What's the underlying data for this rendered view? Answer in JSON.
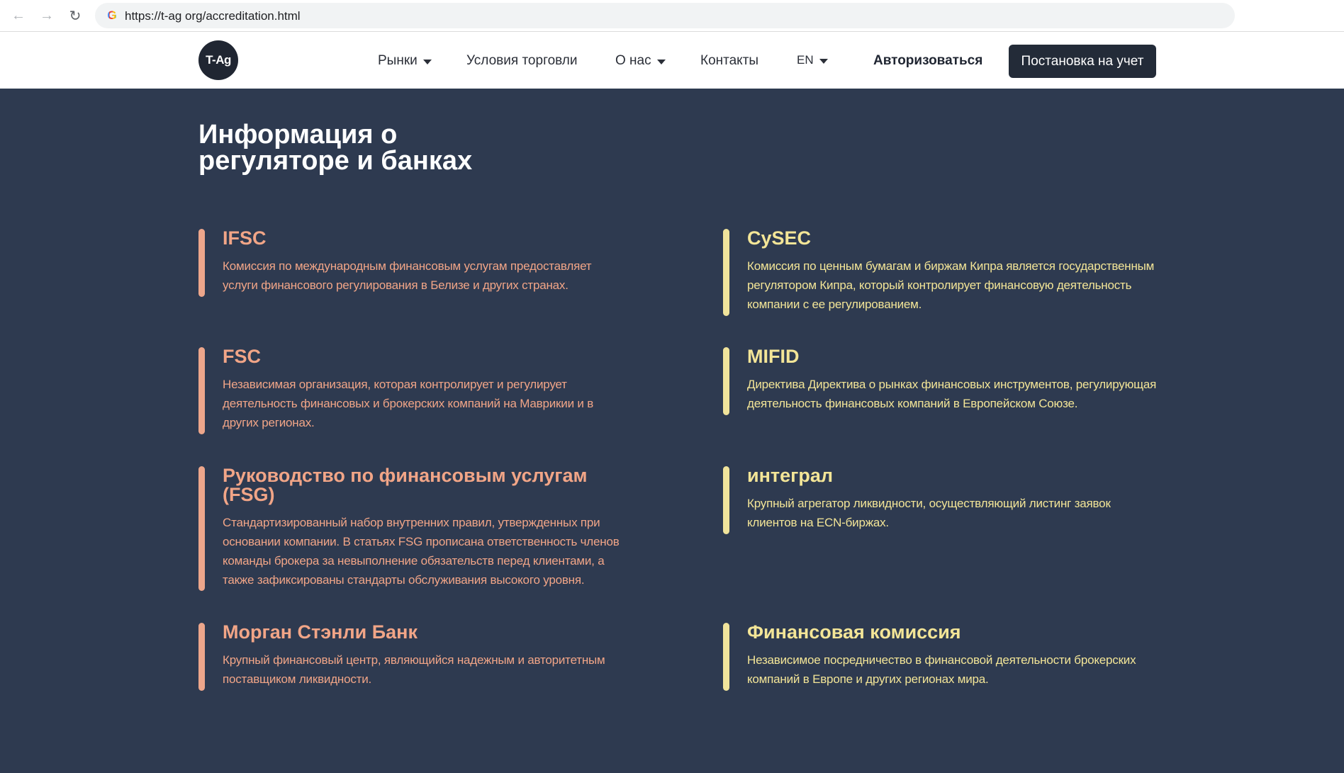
{
  "browser": {
    "url": "https://t-ag org/accreditation.html"
  },
  "header": {
    "logo_text": "T-Ag",
    "menu": [
      {
        "label": "Рынки",
        "dropdown": true
      },
      {
        "label": "Условия торговли",
        "dropdown": false
      },
      {
        "label": "О нас",
        "dropdown": true
      },
      {
        "label": "Контакты",
        "dropdown": false
      },
      {
        "label": "EN",
        "dropdown": true
      }
    ],
    "login_label": "Авторизоваться",
    "register_label": "Постановка на учет"
  },
  "page": {
    "title_line1": "Информация о",
    "title_line2": "регуляторе и банках"
  },
  "cards": [
    {
      "title": "IFSC",
      "desc": "Комиссия по международным финансовым услугам предоставляет услуги финансового регулирования в Белизе и других странах."
    },
    {
      "title": "CySEC",
      "desc": "Комиссия по ценным бумагам и биржам Кипра является государственным регулятором Кипра, который контролирует финансовую деятельность компании с ее регулированием."
    },
    {
      "title": "FSC",
      "desc": "Независимая организация, которая контролирует и регулирует деятельность финансовых и брокерских компаний на Маврикии и в других регионах."
    },
    {
      "title": "MIFID",
      "desc": "Директива Директива о рынках финансовых инструментов, регулирующая деятельность финансовых компаний в Европейском Союзе."
    },
    {
      "title": "Руководство по финансовым услугам (FSG)",
      "desc": "Стандартизированный набор внутренних правил, утвержденных при основании компании. В статьях FSG прописана ответственность членов команды брокера за невыполнение обязательств перед клиентами, а также зафиксированы стандарты обслуживания высокого уровня."
    },
    {
      "title": "интеграл",
      "desc": "Крупный агрегатор ликвидности, осуществляющий листинг заявок клиентов на ECN-биржах."
    },
    {
      "title": "Морган Стэнли Банк",
      "desc": "Крупный финансовый центр, являющийся надежным и авторитетным поставщиком ликвидности."
    },
    {
      "title": "Финансовая комиссия",
      "desc": "Независимое посредничество в финансовой деятельности брокерских компаний в Европе и других регионах мира."
    }
  ],
  "colors": {
    "background": "#2e3a50",
    "left_accent": "#f1a587",
    "right_accent": "#f3e597",
    "register_button": "#232b38"
  }
}
